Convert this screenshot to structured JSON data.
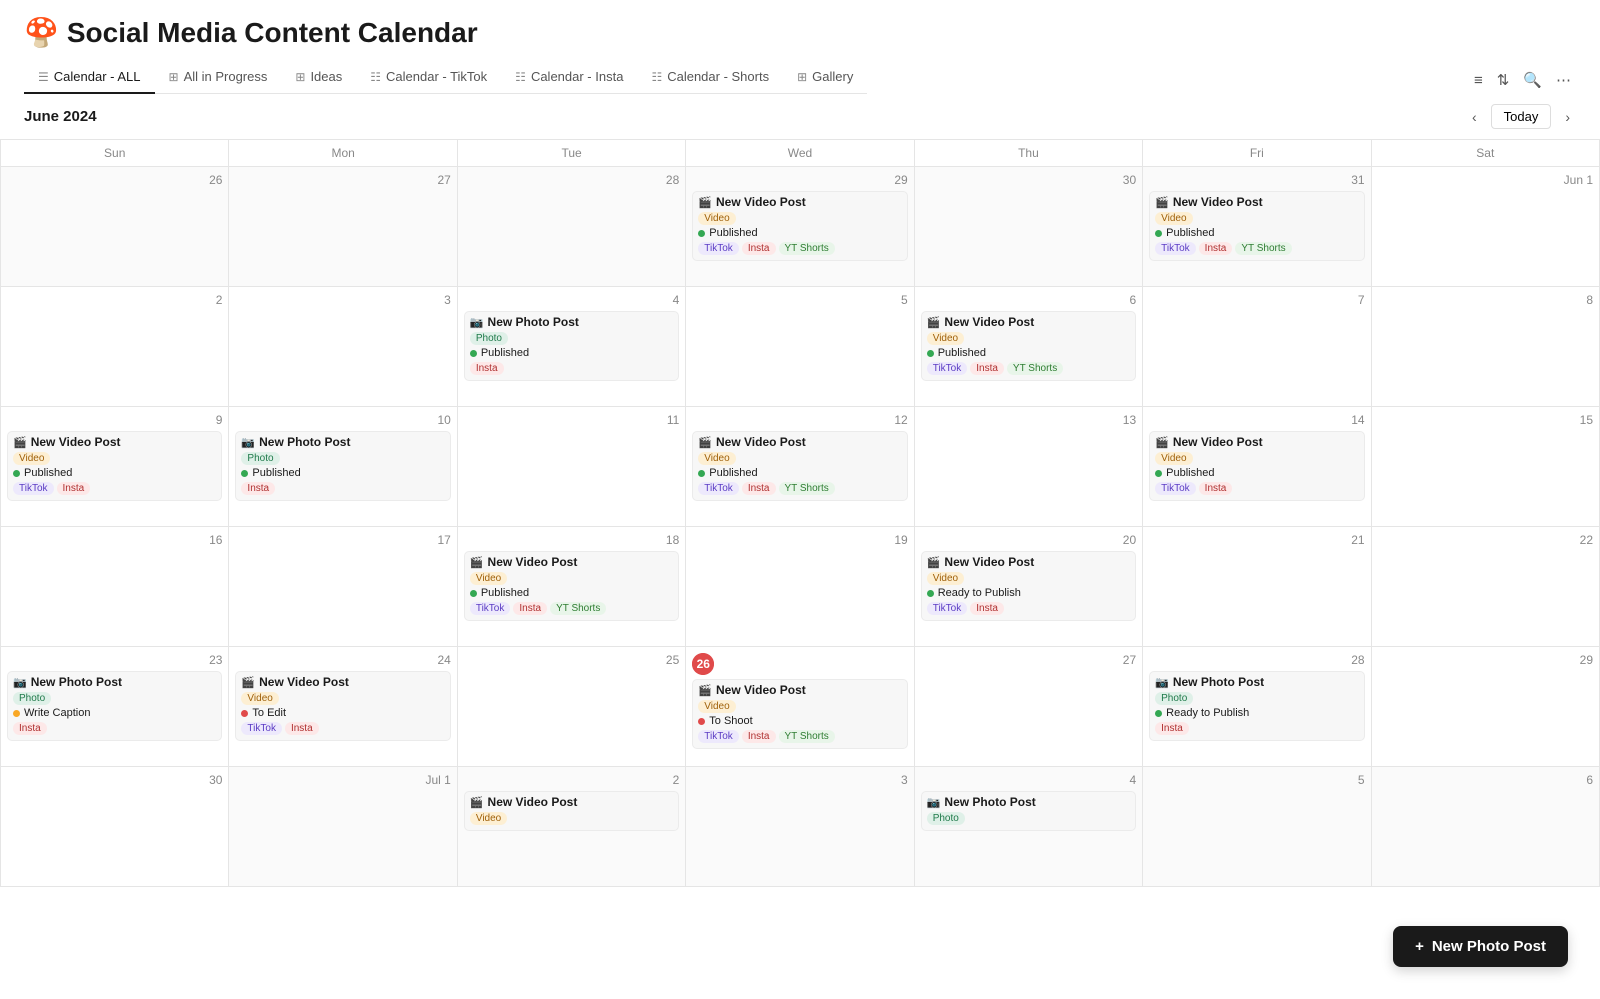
{
  "title": "Social Media Content Calendar",
  "emoji": "🍄",
  "tabs": [
    {
      "id": "calendar-all",
      "label": "Calendar - ALL",
      "icon": "☰",
      "active": true
    },
    {
      "id": "all-in-progress",
      "label": "All in Progress",
      "icon": "⊞"
    },
    {
      "id": "ideas",
      "label": "Ideas",
      "icon": "⊞"
    },
    {
      "id": "calendar-tiktok",
      "label": "Calendar - TikTok",
      "icon": "☷"
    },
    {
      "id": "calendar-insta",
      "label": "Calendar - Insta",
      "icon": "☷"
    },
    {
      "id": "calendar-shorts",
      "label": "Calendar - Shorts",
      "icon": "☷"
    },
    {
      "id": "gallery",
      "label": "Gallery",
      "icon": "⊞"
    }
  ],
  "month": "June 2024",
  "today_label": "Today",
  "day_headers": [
    "Sun",
    "Mon",
    "Tue",
    "Wed",
    "Thu",
    "Fri",
    "Sat"
  ],
  "new_post_btn": "New Photo Post",
  "new_video_btn": "New Video Post",
  "calendar": [
    [
      {
        "date": "26",
        "current": false,
        "today": false,
        "events": []
      },
      {
        "date": "27",
        "current": false,
        "today": false,
        "events": []
      },
      {
        "date": "28",
        "current": false,
        "today": false,
        "events": []
      },
      {
        "date": "29",
        "current": false,
        "today": false,
        "events": [
          {
            "emoji": "🎬",
            "title": "New Video Post",
            "type": "Video",
            "type_tag": "video",
            "status": "Published",
            "status_type": "published",
            "platforms": [
              "TikTok",
              "Insta",
              "YT Shorts"
            ]
          }
        ]
      },
      {
        "date": "30",
        "current": false,
        "today": false,
        "events": []
      },
      {
        "date": "31",
        "current": false,
        "today": false,
        "events": [
          {
            "emoji": "🎬",
            "title": "New Video Post",
            "type": "Video",
            "type_tag": "video",
            "status": "Published",
            "status_type": "published",
            "platforms": [
              "TikTok",
              "Insta",
              "YT Shorts"
            ]
          }
        ]
      },
      {
        "date": "Jun 1",
        "current": true,
        "today": false,
        "events": []
      }
    ],
    [
      {
        "date": "2",
        "current": true,
        "today": false,
        "events": []
      },
      {
        "date": "3",
        "current": true,
        "today": false,
        "events": []
      },
      {
        "date": "4",
        "current": true,
        "today": false,
        "events": [
          {
            "emoji": "📷",
            "title": "New Photo Post",
            "type": "Photo",
            "type_tag": "photo",
            "status": "Published",
            "status_type": "published",
            "platforms": [
              "Insta"
            ]
          }
        ]
      },
      {
        "date": "5",
        "current": true,
        "today": false,
        "events": []
      },
      {
        "date": "6",
        "current": true,
        "today": false,
        "events": [
          {
            "emoji": "🎬",
            "title": "New Video Post",
            "type": "Video",
            "type_tag": "video",
            "status": "Published",
            "status_type": "published",
            "platforms": [
              "TikTok",
              "Insta",
              "YT Shorts"
            ]
          }
        ]
      },
      {
        "date": "7",
        "current": true,
        "today": false,
        "events": []
      },
      {
        "date": "8",
        "current": true,
        "today": false,
        "events": []
      }
    ],
    [
      {
        "date": "9",
        "current": true,
        "today": false,
        "events": [
          {
            "emoji": "🎬",
            "title": "New Video Post",
            "type": "Video",
            "type_tag": "video",
            "status": "Published",
            "status_type": "published",
            "platforms": [
              "TikTok",
              "Insta"
            ]
          }
        ]
      },
      {
        "date": "10",
        "current": true,
        "today": false,
        "events": [
          {
            "emoji": "📷",
            "title": "New Photo Post",
            "type": "Photo",
            "type_tag": "photo",
            "status": "Published",
            "status_type": "published",
            "platforms": [
              "Insta"
            ]
          }
        ]
      },
      {
        "date": "11",
        "current": true,
        "today": false,
        "events": []
      },
      {
        "date": "12",
        "current": true,
        "today": false,
        "events": [
          {
            "emoji": "🎬",
            "title": "New Video Post",
            "type": "Video",
            "type_tag": "video",
            "status": "Published",
            "status_type": "published",
            "platforms": [
              "TikTok",
              "Insta",
              "YT Shorts"
            ]
          }
        ]
      },
      {
        "date": "13",
        "current": true,
        "today": false,
        "events": []
      },
      {
        "date": "14",
        "current": true,
        "today": false,
        "events": [
          {
            "emoji": "🎬",
            "title": "New Video Post",
            "type": "Video",
            "type_tag": "video",
            "status": "Published",
            "status_type": "published",
            "platforms": [
              "TikTok",
              "Insta"
            ]
          }
        ]
      },
      {
        "date": "15",
        "current": true,
        "today": false,
        "events": []
      }
    ],
    [
      {
        "date": "16",
        "current": true,
        "today": false,
        "events": []
      },
      {
        "date": "17",
        "current": true,
        "today": false,
        "events": []
      },
      {
        "date": "18",
        "current": true,
        "today": false,
        "events": [
          {
            "emoji": "🎬",
            "title": "New Video Post",
            "type": "Video",
            "type_tag": "video",
            "status": "Published",
            "status_type": "published",
            "platforms": [
              "TikTok",
              "Insta",
              "YT Shorts"
            ]
          }
        ]
      },
      {
        "date": "19",
        "current": true,
        "today": false,
        "events": []
      },
      {
        "date": "20",
        "current": true,
        "today": false,
        "events": [
          {
            "emoji": "🎬",
            "title": "New Video Post",
            "type": "Video",
            "type_tag": "video",
            "status": "Ready to Publish",
            "status_type": "ready",
            "platforms": [
              "TikTok",
              "Insta"
            ]
          }
        ]
      },
      {
        "date": "21",
        "current": true,
        "today": false,
        "events": []
      },
      {
        "date": "22",
        "current": true,
        "today": false,
        "events": []
      }
    ],
    [
      {
        "date": "23",
        "current": true,
        "today": false,
        "events": [
          {
            "emoji": "📷",
            "title": "New Photo Post",
            "type": "Photo",
            "type_tag": "photo",
            "status": "Write Caption",
            "status_type": "write",
            "platforms": [
              "Insta"
            ]
          }
        ]
      },
      {
        "date": "24",
        "current": true,
        "today": false,
        "events": [
          {
            "emoji": "🎬",
            "title": "New Video Post",
            "type": "Video",
            "type_tag": "video",
            "status": "To Edit",
            "status_type": "to-edit",
            "platforms": [
              "TikTok",
              "Insta"
            ]
          }
        ]
      },
      {
        "date": "25",
        "current": true,
        "today": false,
        "events": []
      },
      {
        "date": "26",
        "current": true,
        "today": true,
        "events": [
          {
            "emoji": "🎬",
            "title": "New Video Post",
            "type": "Video",
            "type_tag": "video",
            "status": "To Shoot",
            "status_type": "to-shoot",
            "platforms": [
              "TikTok",
              "Insta",
              "YT Shorts"
            ]
          }
        ]
      },
      {
        "date": "27",
        "current": true,
        "today": false,
        "events": []
      },
      {
        "date": "28",
        "current": true,
        "today": false,
        "events": [
          {
            "emoji": "📷",
            "title": "New Photo Post",
            "type": "Photo",
            "type_tag": "photo",
            "status": "Ready to Publish",
            "status_type": "ready",
            "platforms": [
              "Insta"
            ]
          }
        ]
      },
      {
        "date": "29",
        "current": true,
        "today": false,
        "events": []
      }
    ],
    [
      {
        "date": "30",
        "current": true,
        "today": false,
        "events": []
      },
      {
        "date": "Jul 1",
        "current": false,
        "today": false,
        "events": []
      },
      {
        "date": "2",
        "current": false,
        "today": false,
        "events": [
          {
            "emoji": "🎬",
            "title": "New Video Post",
            "type": "Video",
            "type_tag": "video",
            "status": "",
            "status_type": "",
            "platforms": []
          }
        ]
      },
      {
        "date": "3",
        "current": false,
        "today": false,
        "events": []
      },
      {
        "date": "4",
        "current": false,
        "today": false,
        "events": [
          {
            "emoji": "📷",
            "title": "New Photo Post",
            "type": "Photo",
            "type_tag": "photo",
            "status": "",
            "status_type": "",
            "platforms": []
          }
        ]
      },
      {
        "date": "5",
        "current": false,
        "today": false,
        "events": []
      },
      {
        "date": "6",
        "current": false,
        "today": false,
        "events": []
      }
    ]
  ],
  "platform_tags": {
    "TikTok": "tiktok",
    "Insta": "insta",
    "YT Shorts": "ytshorts"
  }
}
